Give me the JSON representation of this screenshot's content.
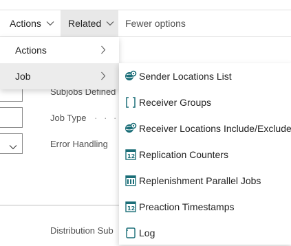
{
  "action_bar": {
    "actions_label": "Actions",
    "related_label": "Related",
    "fewer_label": "Fewer options"
  },
  "form": {
    "subjobs_label": "Subjobs Defined",
    "job_type_label": "Job Type",
    "error_handling_label": "Error Handling",
    "distribution_label": "Distribution Sub"
  },
  "related_menu": {
    "items": [
      {
        "label": "Actions"
      },
      {
        "label": "Job"
      }
    ]
  },
  "job_submenu": {
    "items": [
      {
        "label": "Sender Locations List",
        "icon": "location-gear-icon"
      },
      {
        "label": "Receiver Groups",
        "icon": "brackets-icon"
      },
      {
        "label": "Receiver Locations Include/Exclude",
        "icon": "location-gear-icon"
      },
      {
        "label": "Replication Counters",
        "icon": "counter-icon"
      },
      {
        "label": "Replenishment Parallel Jobs",
        "icon": "parallel-jobs-icon"
      },
      {
        "label": "Preaction Timestamps",
        "icon": "counter-icon"
      },
      {
        "label": "Log",
        "icon": "log-icon"
      }
    ]
  },
  "colors": {
    "icon_teal": "#1b6e78",
    "hover_gray": "#ececec"
  }
}
